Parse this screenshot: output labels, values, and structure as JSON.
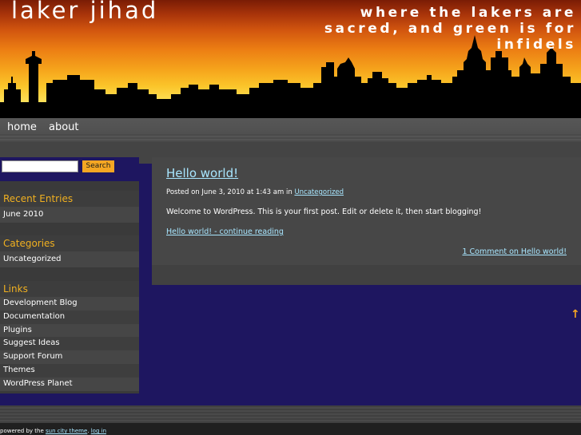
{
  "header": {
    "site_title": "laker jihad",
    "tagline": "where the lakers are sacred, and green is for infidels"
  },
  "nav": {
    "items": [
      {
        "label": "home"
      },
      {
        "label": "about"
      }
    ]
  },
  "sidebar": {
    "search": {
      "value": "",
      "button_label": "Search"
    },
    "recent_entries": {
      "heading": "Recent Entries",
      "items": [
        "June 2010"
      ]
    },
    "categories": {
      "heading": "Categories",
      "items": [
        "Uncategorized"
      ]
    },
    "links": {
      "heading": "Links",
      "items": [
        "Development Blog",
        "Documentation",
        "Plugins",
        "Suggest Ideas",
        "Support Forum",
        "Themes",
        "WordPress Planet"
      ]
    }
  },
  "post": {
    "title": "Hello world!",
    "meta_prefix": "Posted on June 3, 2010 at 1:43 am in",
    "category": "Uncategorized",
    "body": "Welcome to WordPress. This is your first post. Edit or delete it, then start blogging!",
    "more_link": "Hello world! - continue reading",
    "comments_link": "1 Comment on Hello world!"
  },
  "back_to_top": "↑",
  "footer": {
    "prefix": "powered by the",
    "theme_link": "sun city theme",
    "separator": ".",
    "login_link": "log in"
  },
  "colors": {
    "accent": "#f5a623",
    "link": "#a8e6ff",
    "background": "#1e1660",
    "panel": "#474747"
  }
}
